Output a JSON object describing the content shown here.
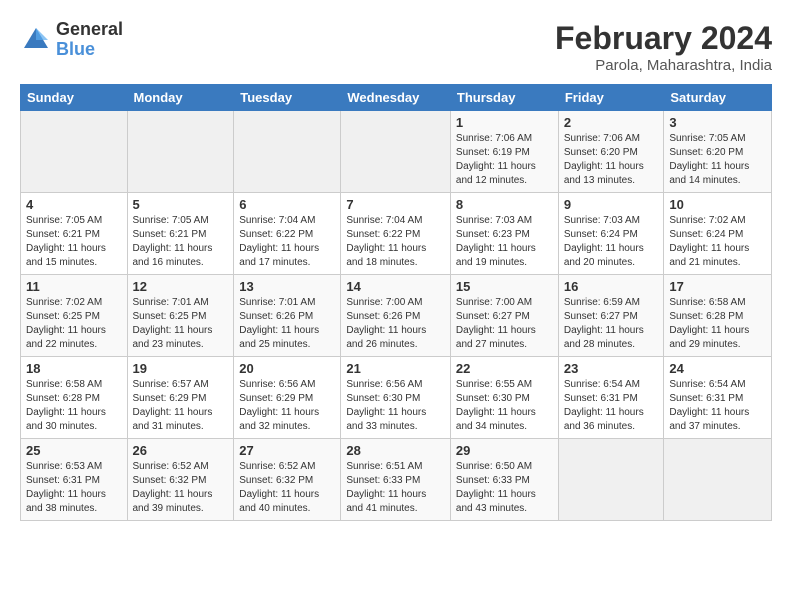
{
  "header": {
    "logo_general": "General",
    "logo_blue": "Blue",
    "month_year": "February 2024",
    "location": "Parola, Maharashtra, India"
  },
  "days_of_week": [
    "Sunday",
    "Monday",
    "Tuesday",
    "Wednesday",
    "Thursday",
    "Friday",
    "Saturday"
  ],
  "weeks": [
    [
      {
        "day": "",
        "info": ""
      },
      {
        "day": "",
        "info": ""
      },
      {
        "day": "",
        "info": ""
      },
      {
        "day": "",
        "info": ""
      },
      {
        "day": "1",
        "info": "Sunrise: 7:06 AM\nSunset: 6:19 PM\nDaylight: 11 hours\nand 12 minutes."
      },
      {
        "day": "2",
        "info": "Sunrise: 7:06 AM\nSunset: 6:20 PM\nDaylight: 11 hours\nand 13 minutes."
      },
      {
        "day": "3",
        "info": "Sunrise: 7:05 AM\nSunset: 6:20 PM\nDaylight: 11 hours\nand 14 minutes."
      }
    ],
    [
      {
        "day": "4",
        "info": "Sunrise: 7:05 AM\nSunset: 6:21 PM\nDaylight: 11 hours\nand 15 minutes."
      },
      {
        "day": "5",
        "info": "Sunrise: 7:05 AM\nSunset: 6:21 PM\nDaylight: 11 hours\nand 16 minutes."
      },
      {
        "day": "6",
        "info": "Sunrise: 7:04 AM\nSunset: 6:22 PM\nDaylight: 11 hours\nand 17 minutes."
      },
      {
        "day": "7",
        "info": "Sunrise: 7:04 AM\nSunset: 6:22 PM\nDaylight: 11 hours\nand 18 minutes."
      },
      {
        "day": "8",
        "info": "Sunrise: 7:03 AM\nSunset: 6:23 PM\nDaylight: 11 hours\nand 19 minutes."
      },
      {
        "day": "9",
        "info": "Sunrise: 7:03 AM\nSunset: 6:24 PM\nDaylight: 11 hours\nand 20 minutes."
      },
      {
        "day": "10",
        "info": "Sunrise: 7:02 AM\nSunset: 6:24 PM\nDaylight: 11 hours\nand 21 minutes."
      }
    ],
    [
      {
        "day": "11",
        "info": "Sunrise: 7:02 AM\nSunset: 6:25 PM\nDaylight: 11 hours\nand 22 minutes."
      },
      {
        "day": "12",
        "info": "Sunrise: 7:01 AM\nSunset: 6:25 PM\nDaylight: 11 hours\nand 23 minutes."
      },
      {
        "day": "13",
        "info": "Sunrise: 7:01 AM\nSunset: 6:26 PM\nDaylight: 11 hours\nand 25 minutes."
      },
      {
        "day": "14",
        "info": "Sunrise: 7:00 AM\nSunset: 6:26 PM\nDaylight: 11 hours\nand 26 minutes."
      },
      {
        "day": "15",
        "info": "Sunrise: 7:00 AM\nSunset: 6:27 PM\nDaylight: 11 hours\nand 27 minutes."
      },
      {
        "day": "16",
        "info": "Sunrise: 6:59 AM\nSunset: 6:27 PM\nDaylight: 11 hours\nand 28 minutes."
      },
      {
        "day": "17",
        "info": "Sunrise: 6:58 AM\nSunset: 6:28 PM\nDaylight: 11 hours\nand 29 minutes."
      }
    ],
    [
      {
        "day": "18",
        "info": "Sunrise: 6:58 AM\nSunset: 6:28 PM\nDaylight: 11 hours\nand 30 minutes."
      },
      {
        "day": "19",
        "info": "Sunrise: 6:57 AM\nSunset: 6:29 PM\nDaylight: 11 hours\nand 31 minutes."
      },
      {
        "day": "20",
        "info": "Sunrise: 6:56 AM\nSunset: 6:29 PM\nDaylight: 11 hours\nand 32 minutes."
      },
      {
        "day": "21",
        "info": "Sunrise: 6:56 AM\nSunset: 6:30 PM\nDaylight: 11 hours\nand 33 minutes."
      },
      {
        "day": "22",
        "info": "Sunrise: 6:55 AM\nSunset: 6:30 PM\nDaylight: 11 hours\nand 34 minutes."
      },
      {
        "day": "23",
        "info": "Sunrise: 6:54 AM\nSunset: 6:31 PM\nDaylight: 11 hours\nand 36 minutes."
      },
      {
        "day": "24",
        "info": "Sunrise: 6:54 AM\nSunset: 6:31 PM\nDaylight: 11 hours\nand 37 minutes."
      }
    ],
    [
      {
        "day": "25",
        "info": "Sunrise: 6:53 AM\nSunset: 6:31 PM\nDaylight: 11 hours\nand 38 minutes."
      },
      {
        "day": "26",
        "info": "Sunrise: 6:52 AM\nSunset: 6:32 PM\nDaylight: 11 hours\nand 39 minutes."
      },
      {
        "day": "27",
        "info": "Sunrise: 6:52 AM\nSunset: 6:32 PM\nDaylight: 11 hours\nand 40 minutes."
      },
      {
        "day": "28",
        "info": "Sunrise: 6:51 AM\nSunset: 6:33 PM\nDaylight: 11 hours\nand 41 minutes."
      },
      {
        "day": "29",
        "info": "Sunrise: 6:50 AM\nSunset: 6:33 PM\nDaylight: 11 hours\nand 43 minutes."
      },
      {
        "day": "",
        "info": ""
      },
      {
        "day": "",
        "info": ""
      }
    ]
  ]
}
